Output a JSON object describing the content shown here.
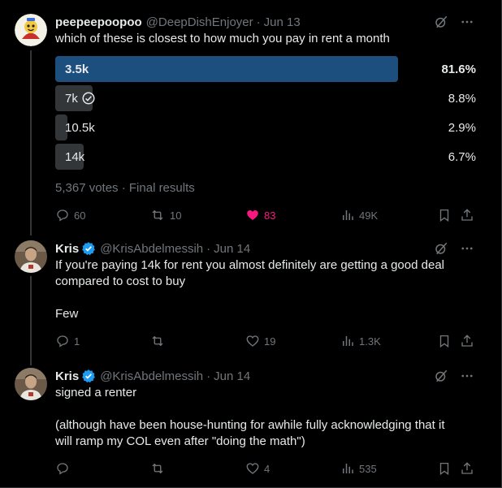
{
  "colors": {
    "background": "#000000",
    "text_primary": "#e7e9ea",
    "text_secondary": "#71767b",
    "poll_winner": "#1d4f7e",
    "poll_other": "#333639",
    "like_active": "#f91880",
    "verified": "#1d9bf0"
  },
  "tweets": [
    {
      "name": "peepeepoopoo",
      "handle": "@DeepDishEnjoyer",
      "separator": "·",
      "date": "Jun 13",
      "text": "which of these is closest to how much you pay in rent a month",
      "avatar_icon": "cartoon-avatar",
      "verified": false,
      "poll": {
        "options": [
          {
            "label": "3.5k",
            "percent_text": "81.6%",
            "percent": 81.6,
            "winner": true,
            "voted": false
          },
          {
            "label": "7k",
            "percent_text": "8.8%",
            "percent": 8.8,
            "winner": false,
            "voted": true
          },
          {
            "label": "10.5k",
            "percent_text": "2.9%",
            "percent": 2.9,
            "winner": false,
            "voted": false
          },
          {
            "label": "14k",
            "percent_text": "6.7%",
            "percent": 6.7,
            "winner": false,
            "voted": false
          }
        ],
        "meta": "5,367 votes · Final results"
      },
      "actions": {
        "replies": "60",
        "retweets": "10",
        "likes": "83",
        "views": "49K",
        "liked": true
      }
    },
    {
      "name": "Kris",
      "handle": "@KrisAbdelmessih",
      "separator": "·",
      "date": "Jun 14",
      "text": "If you're paying 14k for rent you almost definitely are getting a good deal\ncompared to cost to buy\n\nFew",
      "avatar_icon": "photo-avatar",
      "verified": true,
      "actions": {
        "replies": "1",
        "retweets": "",
        "likes": "19",
        "views": "1.3K",
        "liked": false
      }
    },
    {
      "name": "Kris",
      "handle": "@KrisAbdelmessih",
      "separator": "·",
      "date": "Jun 14",
      "text": "signed a renter\n\n(although have been house-hunting for awhile fully acknowledging that it\nwill ramp my COL even after \"doing the math\")",
      "avatar_icon": "photo-avatar",
      "verified": true,
      "actions": {
        "replies": "",
        "retweets": "",
        "likes": "4",
        "views": "535",
        "liked": false
      }
    }
  ]
}
